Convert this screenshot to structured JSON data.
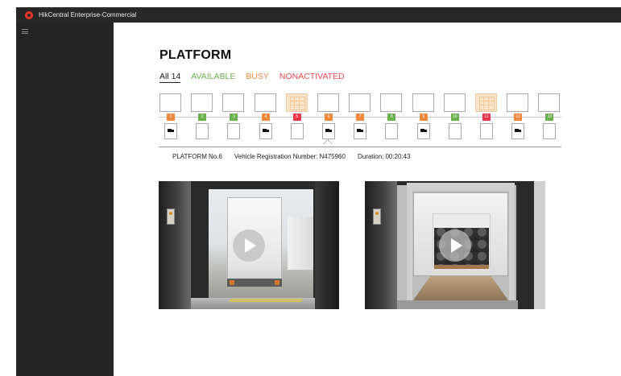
{
  "app": {
    "title": "HikCentral Enterprise-Commercial"
  },
  "page": {
    "title": "PLATFORM"
  },
  "filters": [
    {
      "label": "All 14",
      "key": "all",
      "color": "#222222"
    },
    {
      "label": "AVAILABLE",
      "key": "available",
      "color": "#6ab04c"
    },
    {
      "label": "BUSY",
      "key": "busy",
      "color": "#f0883e"
    },
    {
      "label": "NONACTIVATED",
      "key": "nonactivated",
      "color": "#e84a4a"
    }
  ],
  "status_colors": {
    "busy": "#f0883e",
    "available": "#6ab04c",
    "nonactivated": "#e8354a"
  },
  "platforms": [
    {
      "number": "1",
      "status": "busy",
      "vehicle": true,
      "door_icon": ""
    },
    {
      "number": "2",
      "status": "available",
      "vehicle": false,
      "door_icon": ""
    },
    {
      "number": "3",
      "status": "available",
      "vehicle": false,
      "door_icon": ""
    },
    {
      "number": "4",
      "status": "busy",
      "vehicle": true,
      "door_icon": ""
    },
    {
      "number": "5",
      "status": "nonactivated",
      "vehicle": false,
      "door_icon": "grid-icon"
    },
    {
      "number": "6",
      "status": "busy",
      "vehicle": true,
      "door_icon": ""
    },
    {
      "number": "7",
      "status": "busy",
      "vehicle": true,
      "door_icon": ""
    },
    {
      "number": "8",
      "status": "available",
      "vehicle": false,
      "door_icon": ""
    },
    {
      "number": "9",
      "status": "busy",
      "vehicle": true,
      "door_icon": ""
    },
    {
      "number": "10",
      "status": "available",
      "vehicle": false,
      "door_icon": ""
    },
    {
      "number": "11",
      "status": "nonactivated",
      "vehicle": false,
      "door_icon": "grid-icon"
    },
    {
      "number": "12",
      "status": "busy",
      "vehicle": true,
      "door_icon": ""
    },
    {
      "number": "13",
      "status": "available",
      "vehicle": false,
      "door_icon": ""
    }
  ],
  "selected_platform": "6",
  "details": {
    "platform_label": "PLATFORM",
    "platform_value": "No.6",
    "plate_label": "Vehicle Registration Number:",
    "plate_value": "N475960",
    "duration_label": "Duration:",
    "duration_value": "00:20:43"
  },
  "videos": [
    {
      "name": "dock-camera-truck",
      "icon": "play-icon"
    },
    {
      "name": "dock-camera-cargo",
      "icon": "play-icon"
    }
  ]
}
